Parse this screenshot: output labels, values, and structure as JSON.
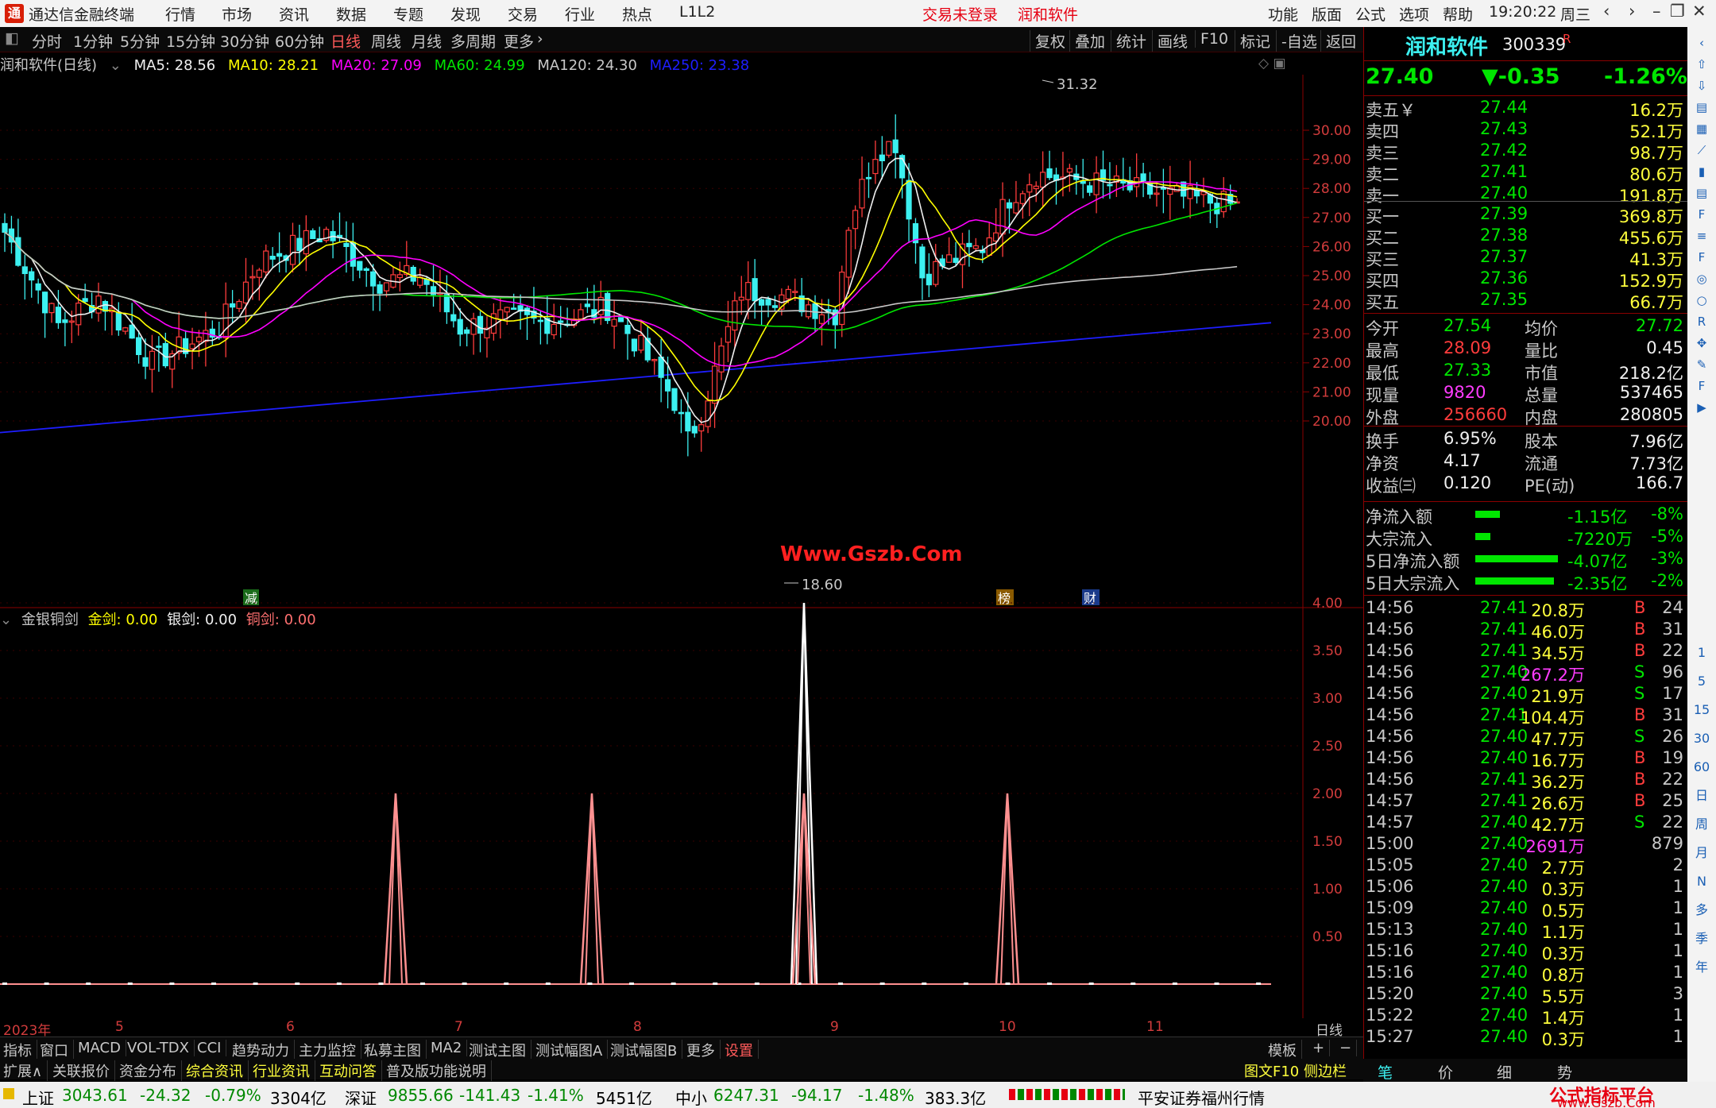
{
  "titlebar": {
    "app_name": "通达信金融终端",
    "menus": [
      "行情",
      "市场",
      "资讯",
      "数据",
      "专题",
      "发现",
      "交易",
      "行业",
      "热点",
      "L1L2"
    ],
    "login": "交易未登录",
    "stock": "润和软件",
    "right_menus": [
      "功能",
      "版面",
      "公式",
      "选项",
      "帮助"
    ],
    "time": "19:20:22",
    "weekday": "周三"
  },
  "tabs": {
    "periods": [
      "分时",
      "1分钟",
      "5分钟",
      "15分钟",
      "30分钟",
      "60分钟",
      "日线",
      "周线",
      "月线",
      "多周期",
      "更多"
    ],
    "active": "日线",
    "tools": [
      "复权",
      "叠加",
      "统计",
      "画线",
      "F10",
      "标记",
      "-自选",
      "返回"
    ]
  },
  "chart_info": {
    "title": "润和软件(日线)",
    "ma": [
      {
        "label": "MA5: 28.56",
        "color": "#f0f0f0"
      },
      {
        "label": "MA10: 28.21",
        "color": "#ffff00"
      },
      {
        "label": "MA20: 27.09",
        "color": "#ff00ff"
      },
      {
        "label": "MA60: 24.99",
        "color": "#00e600"
      },
      {
        "label": "MA120: 24.30",
        "color": "#c8c8c8"
      },
      {
        "label": "MA250: 23.38",
        "color": "#1e1eff"
      }
    ]
  },
  "price_axis": [
    "30.00",
    "29.00",
    "28.00",
    "27.00",
    "26.00",
    "25.00",
    "24.00",
    "23.00",
    "22.00",
    "21.00",
    "20.00"
  ],
  "annotations": {
    "high": "31.32",
    "low": "18.60",
    "watermark": "Www.Gszb.Com",
    "events": [
      "减",
      "榜",
      "财"
    ]
  },
  "indicator": {
    "name": "金银铜剑",
    "gold": "金剑: 0.00",
    "silver": "银剑: 0.00",
    "copper": "铜剑: 0.00",
    "axis": [
      "4.00",
      "3.50",
      "3.00",
      "2.50",
      "2.00",
      "1.50",
      "1.00",
      "0.50"
    ]
  },
  "chart_data": {
    "type": "line",
    "series": [
      {
        "name": "银剑",
        "values": [
          {
            "x": "2023-09-13",
            "y": 4.0
          }
        ]
      },
      {
        "name": "铜剑",
        "values": [
          {
            "x": "2023-06-07",
            "y": 2.0
          },
          {
            "x": "2023-07-14",
            "y": 2.0
          },
          {
            "x": "2023-09-13",
            "y": 2.0
          },
          {
            "x": "2023-10-19",
            "y": 2.0
          }
        ]
      }
    ],
    "ylim": [
      0,
      4.0
    ]
  },
  "xaxis": {
    "labels": [
      "2023年",
      "5",
      "6",
      "7",
      "8",
      "9",
      "10",
      "11"
    ],
    "period": "日线"
  },
  "bottom_tabs": [
    "指标",
    "窗口",
    "MACD",
    "VOL-TDX",
    "CCI",
    "趋势动力",
    "主力监控",
    "私募主图",
    "MA2",
    "测试主图",
    "测试幅图A",
    "测试幅图B",
    "更多",
    "设置"
  ],
  "right_bottom_tabs": [
    "模板",
    "+",
    "−"
  ],
  "ext_tabs": [
    "扩展∧",
    "关联报价",
    "资金分布",
    "综合资讯",
    "行业资讯",
    "互动问答",
    "普及版功能说明"
  ],
  "ext_right": "图文F10 侧边栏《",
  "quote": {
    "name": "润和软件",
    "code": "300339",
    "flag": "R",
    "price": "27.40",
    "change": "▼-0.35",
    "pct": "-1.26%",
    "asks": [
      {
        "l": "卖五￥",
        "p": "27.44",
        "v": "16.2万"
      },
      {
        "l": "卖四",
        "p": "27.43",
        "v": "52.1万"
      },
      {
        "l": "卖三",
        "p": "27.42",
        "v": "98.7万"
      },
      {
        "l": "卖二",
        "p": "27.41",
        "v": "80.6万"
      },
      {
        "l": "卖一",
        "p": "27.40",
        "v": "191.8万"
      }
    ],
    "bids": [
      {
        "l": "买一",
        "p": "27.39",
        "v": "369.8万"
      },
      {
        "l": "买二",
        "p": "27.38",
        "v": "455.6万"
      },
      {
        "l": "买三",
        "p": "27.37",
        "v": "41.3万"
      },
      {
        "l": "买四",
        "p": "27.36",
        "v": "152.9万"
      },
      {
        "l": "买五",
        "p": "27.35",
        "v": "66.7万"
      }
    ],
    "stats1": [
      {
        "a": "今开",
        "av": "27.54",
        "b": "均价",
        "bv": "27.72"
      },
      {
        "a": "最高",
        "av": "28.09",
        "b": "量比",
        "bv": "0.45"
      },
      {
        "a": "最低",
        "av": "27.33",
        "b": "市值",
        "bv": "218.2亿"
      },
      {
        "a": "现量",
        "av": "9820",
        "b": "总量",
        "bv": "537465"
      },
      {
        "a": "外盘",
        "av": "256660",
        "b": "内盘",
        "bv": "280805"
      }
    ],
    "stats2": [
      {
        "a": "换手",
        "av": "6.95%",
        "b": "股本",
        "bv": "7.96亿"
      },
      {
        "a": "净资",
        "av": "4.17",
        "b": "流通",
        "bv": "7.73亿"
      },
      {
        "a": "收益㈢",
        "av": "0.120",
        "b": "PE(动)",
        "bv": "166.7"
      }
    ],
    "flows": [
      {
        "l": "净流入额",
        "v": "-1.15亿",
        "p": "-8%",
        "bar": 0.3
      },
      {
        "l": "大宗流入",
        "v": "-7220万",
        "p": "-5%",
        "bar": 0.18
      },
      {
        "l": "5日净流入额",
        "v": "-4.07亿",
        "p": "-3%",
        "bar": 1.0
      },
      {
        "l": "5日大宗流入",
        "v": "-2.35亿",
        "p": "-2%",
        "bar": 0.95
      }
    ]
  },
  "ticks": [
    [
      "14:56",
      "27.41",
      "20.8万",
      "B",
      "24"
    ],
    [
      "14:56",
      "27.41",
      "46.0万",
      "B",
      "31"
    ],
    [
      "14:56",
      "27.41",
      "34.5万",
      "B",
      "22"
    ],
    [
      "14:56",
      "27.40",
      "267.2万",
      "S",
      "96"
    ],
    [
      "14:56",
      "27.40",
      "21.9万",
      "S",
      "17"
    ],
    [
      "14:56",
      "27.41",
      "104.4万",
      "B",
      "31"
    ],
    [
      "14:56",
      "27.40",
      "47.7万",
      "S",
      "26"
    ],
    [
      "14:56",
      "27.40",
      "16.7万",
      "B",
      "19"
    ],
    [
      "14:56",
      "27.41",
      "36.2万",
      "B",
      "22"
    ],
    [
      "14:57",
      "27.41",
      "26.6万",
      "B",
      "25"
    ],
    [
      "14:57",
      "27.40",
      "42.7万",
      "S",
      "22"
    ],
    [
      "15:00",
      "27.40",
      "2691万",
      "",
      "879"
    ],
    [
      "15:05",
      "27.40",
      "2.7万",
      "",
      "2"
    ],
    [
      "15:06",
      "27.40",
      "0.3万",
      "",
      "1"
    ],
    [
      "15:09",
      "27.40",
      "0.5万",
      "",
      "1"
    ],
    [
      "15:13",
      "27.40",
      "1.1万",
      "",
      "1"
    ],
    [
      "15:16",
      "27.40",
      "0.3万",
      "",
      "1"
    ],
    [
      "15:16",
      "27.40",
      "0.8万",
      "",
      "1"
    ],
    [
      "15:20",
      "27.40",
      "5.5万",
      "",
      "3"
    ],
    [
      "15:22",
      "27.40",
      "1.4万",
      "",
      "1"
    ],
    [
      "15:27",
      "27.40",
      "0.3万",
      "",
      "1"
    ]
  ],
  "right_tabs": [
    "笔",
    "价",
    "细",
    "势"
  ],
  "side_icons": [
    "left-arrow-icon",
    "up-arrow-icon",
    "down-arrow-icon",
    "stock-icon",
    "table-icon",
    "chart-icon",
    "candle-icon",
    "news-icon",
    "f10-icon",
    "list-icon",
    "fs-icon",
    "rank-icon",
    "circle-icon",
    "rsi-icon",
    "move-icon",
    "pen-icon",
    "fs2-icon",
    "play-icon"
  ],
  "side_labels": [
    "1",
    "5",
    "15",
    "30",
    "60",
    "日",
    "周",
    "月",
    "N",
    "多",
    "季",
    "年"
  ],
  "status": {
    "sh_name": "上证",
    "sh_val": "3043.61",
    "sh_chg": "-24.32",
    "sh_pct": "-0.79%",
    "sh_amt": "3304亿",
    "sz_name": "深证",
    "sz_val": "9855.66",
    "sz_chg": "-141.43",
    "sz_pct": "-1.41%",
    "sz_amt": "5451亿",
    "zx_name": "中小",
    "zx_val": "6247.31",
    "zx_chg": "-94.17",
    "zx_pct": "-1.48%",
    "zx_amt": "383.3亿",
    "broker": "平安证券福州行情",
    "brand": "公式指标平台",
    "brand_url": "www.Gszb.Com"
  }
}
